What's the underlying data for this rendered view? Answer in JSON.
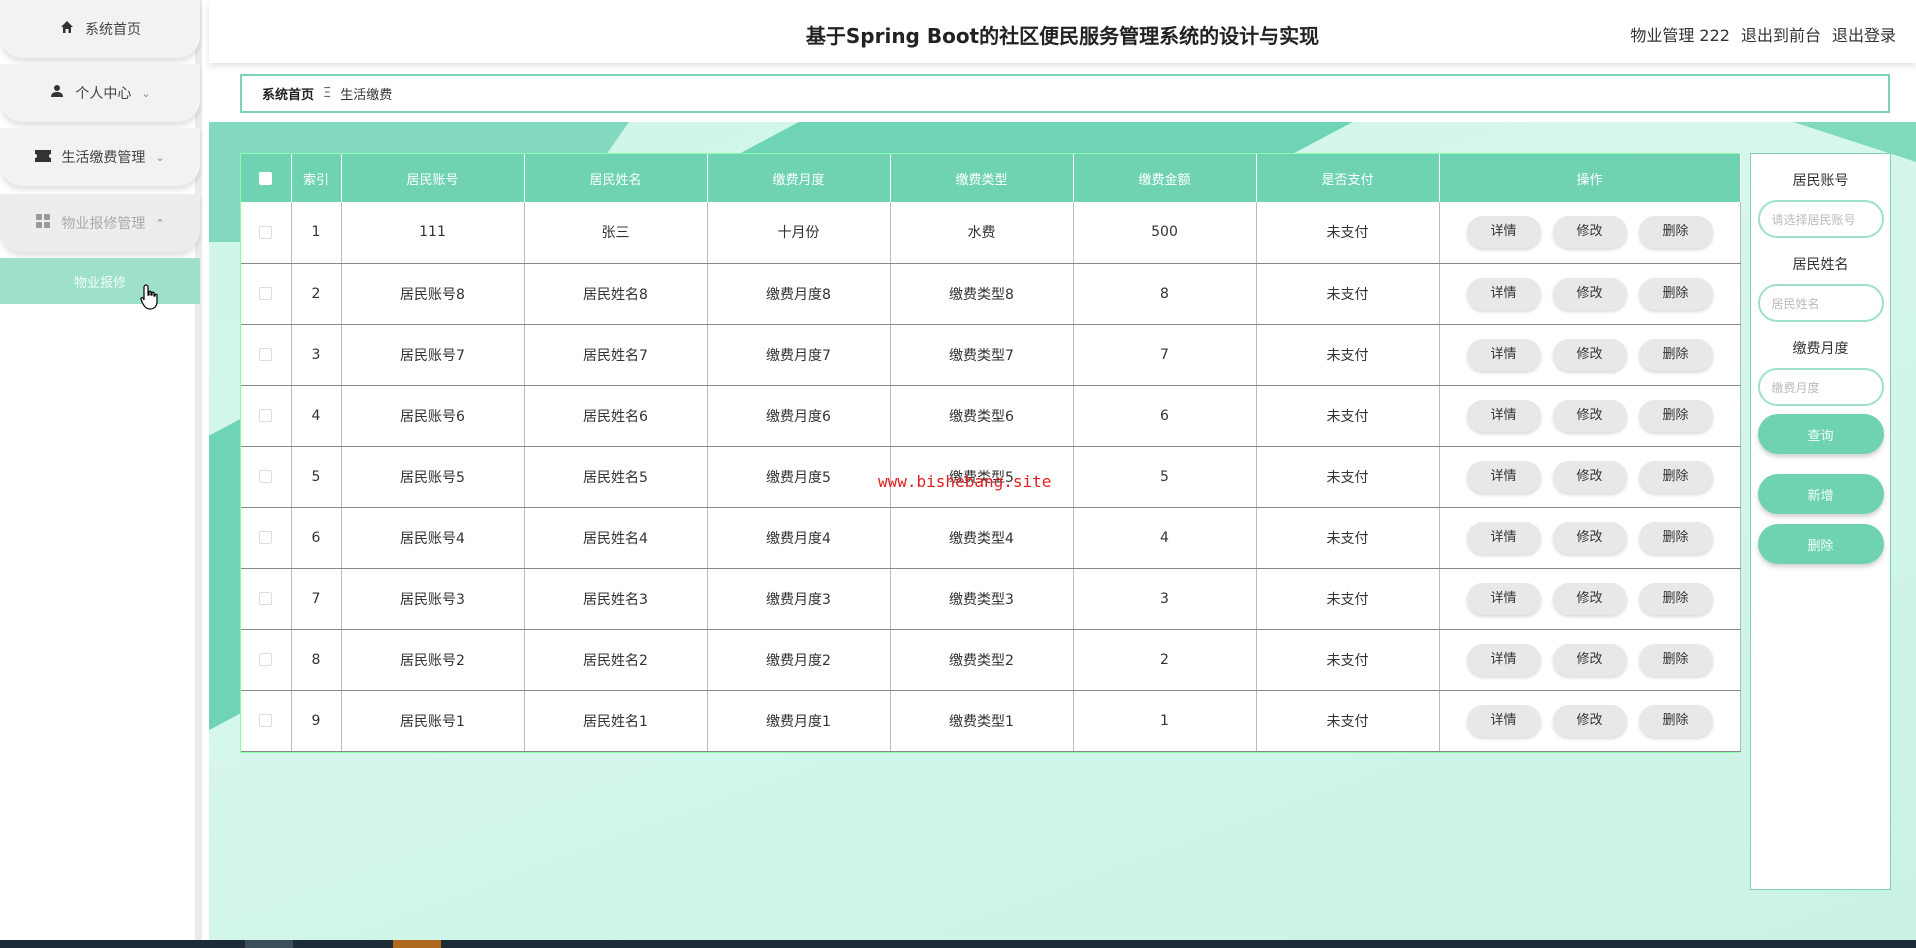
{
  "sidebar": {
    "items": [
      {
        "label": "系统首页",
        "icon": "home-icon",
        "chevron": ""
      },
      {
        "label": "个人中心",
        "icon": "user-icon",
        "chevron": "⌄"
      },
      {
        "label": "生活缴费管理",
        "icon": "ticket-icon",
        "chevron": "⌄"
      },
      {
        "label": "物业报修管理",
        "icon": "grid-icon",
        "chevron": "⌃"
      }
    ],
    "submenu_label": "物业报修"
  },
  "header": {
    "title": "基于Spring Boot的社区便民服务管理系统的设计与实现",
    "user": "物业管理 222",
    "to_front": "退出到前台",
    "logout": "退出登录"
  },
  "breadcrumb": {
    "home": "系统首页",
    "separator": "Ξ",
    "current": "生活缴费"
  },
  "table": {
    "headers": [
      "索引",
      "居民账号",
      "居民姓名",
      "缴费月度",
      "缴费类型",
      "缴费金额",
      "是否支付",
      "操作"
    ],
    "rows": [
      {
        "index": "1",
        "account": "111",
        "name": "张三",
        "month": "十月份",
        "type": "水费",
        "amount": "500",
        "paid": "未支付"
      },
      {
        "index": "2",
        "account": "居民账号8",
        "name": "居民姓名8",
        "month": "缴费月度8",
        "type": "缴费类型8",
        "amount": "8",
        "paid": "未支付"
      },
      {
        "index": "3",
        "account": "居民账号7",
        "name": "居民姓名7",
        "month": "缴费月度7",
        "type": "缴费类型7",
        "amount": "7",
        "paid": "未支付"
      },
      {
        "index": "4",
        "account": "居民账号6",
        "name": "居民姓名6",
        "month": "缴费月度6",
        "type": "缴费类型6",
        "amount": "6",
        "paid": "未支付"
      },
      {
        "index": "5",
        "account": "居民账号5",
        "name": "居民姓名5",
        "month": "缴费月度5",
        "type": "缴费类型5",
        "amount": "5",
        "paid": "未支付"
      },
      {
        "index": "6",
        "account": "居民账号4",
        "name": "居民姓名4",
        "month": "缴费月度4",
        "type": "缴费类型4",
        "amount": "4",
        "paid": "未支付"
      },
      {
        "index": "7",
        "account": "居民账号3",
        "name": "居民姓名3",
        "month": "缴费月度3",
        "type": "缴费类型3",
        "amount": "3",
        "paid": "未支付"
      },
      {
        "index": "8",
        "account": "居民账号2",
        "name": "居民姓名2",
        "month": "缴费月度2",
        "type": "缴费类型2",
        "amount": "2",
        "paid": "未支付"
      },
      {
        "index": "9",
        "account": "居民账号1",
        "name": "居民姓名1",
        "month": "缴费月度1",
        "type": "缴费类型1",
        "amount": "1",
        "paid": "未支付"
      }
    ],
    "actions": {
      "detail": "详情",
      "edit": "修改",
      "delete": "删除"
    }
  },
  "search": {
    "account_label": "居民账号",
    "account_placeholder": "请选择居民账号",
    "name_label": "居民姓名",
    "name_placeholder": "居民姓名",
    "month_label": "缴费月度",
    "month_placeholder": "缴费月度",
    "query_button": "查询",
    "add_button": "新增",
    "delete_button": "删除"
  },
  "watermark": "www.bishebang.site",
  "colors": {
    "accent": "#6fd3b3",
    "accent_light": "#9ee0c9",
    "border": "#7fd3b7"
  }
}
